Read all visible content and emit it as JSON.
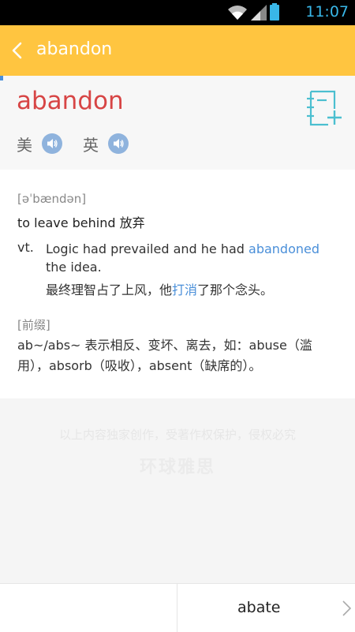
{
  "status_bar": {
    "time": "11:07"
  },
  "app_bar": {
    "title": "abandon"
  },
  "entry": {
    "word": "abandon",
    "pronunciations": [
      {
        "label": "美"
      },
      {
        "label": "英"
      }
    ],
    "phonetic": "[əˈbændən]",
    "definition": "to  leave  behind  放弃",
    "pos": "vt.",
    "example_en_before": "Logic  had  prevailed  and  he  had ",
    "example_en_highlight": "abandoned",
    "example_en_after": "  the  idea.",
    "example_zh_before": "最终理智占了上风，他",
    "example_zh_highlight": "打消",
    "example_zh_after": "了那个念头。",
    "prefix_label": "[前缀]",
    "prefix_text": "ab~/abs~  表示相反、变坏、离去，如：abuse（滥用），absorb（吸收），absent（缺席的）。"
  },
  "copyright": {
    "notice": "以上内容独家创作，受著作权保护，侵权必究",
    "brand": "环球雅思"
  },
  "bottom_nav": {
    "next_word": "abate"
  },
  "colors": {
    "app_bar": "#ffc540",
    "headword": "#d74545",
    "highlight": "#4a8fd9",
    "notebook_icon": "#4bbfd0"
  }
}
